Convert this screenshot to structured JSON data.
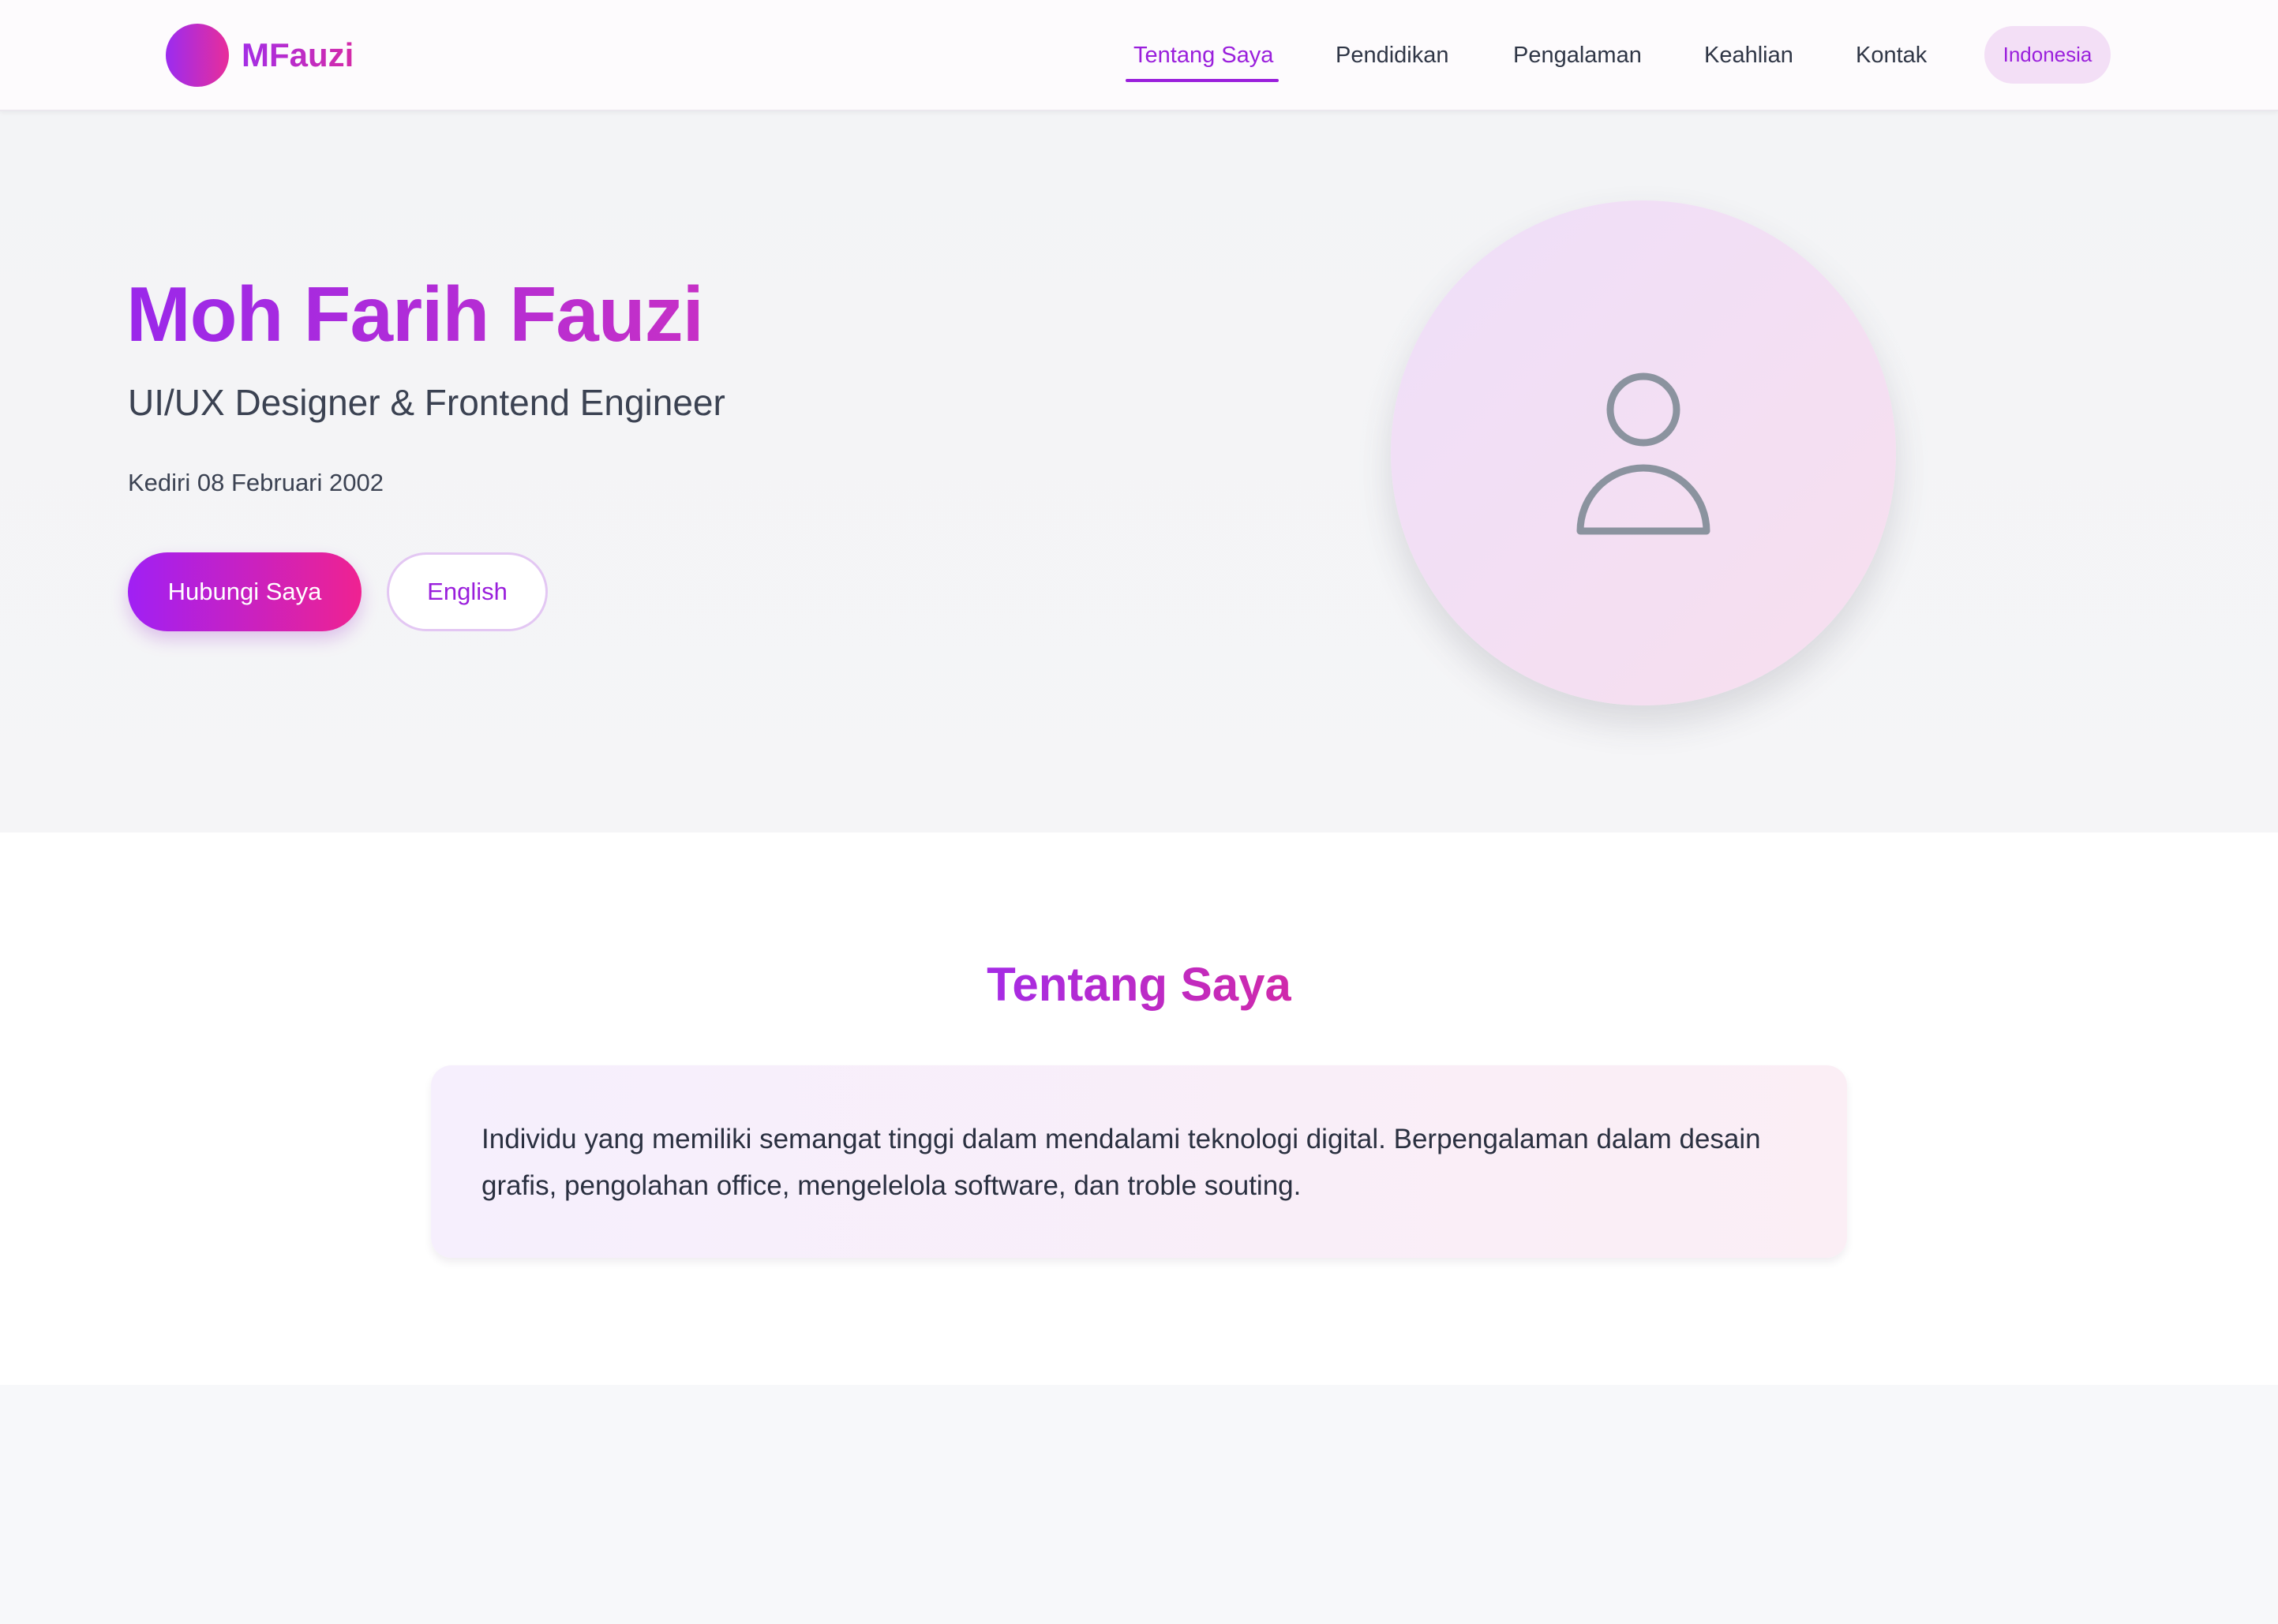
{
  "brand": {
    "name": "MFauzi"
  },
  "nav": {
    "items": [
      {
        "label": "Tentang Saya",
        "active": true
      },
      {
        "label": "Pendidikan",
        "active": false
      },
      {
        "label": "Pengalaman",
        "active": false
      },
      {
        "label": "Keahlian",
        "active": false
      },
      {
        "label": "Kontak",
        "active": false
      }
    ],
    "language": "Indonesia"
  },
  "hero": {
    "name": "Moh Farih Fauzi",
    "role": "UI/UX Designer & Frontend Engineer",
    "birth": "Kediri 08 Februari 2002",
    "primary_button": "Hubungi Saya",
    "secondary_button": "English",
    "avatar_icon": "user-icon"
  },
  "about": {
    "title": "Tentang Saya",
    "text": "Individu yang memiliki semangat tinggi dalam mendalami teknologi digital. Berpengalaman dalam desain grafis, pengolahan office, mengelelola software, dan troble souting."
  },
  "colors": {
    "accent": "#9a1fdc",
    "gradient_start": "#a020f4",
    "gradient_end": "#ef2291"
  }
}
